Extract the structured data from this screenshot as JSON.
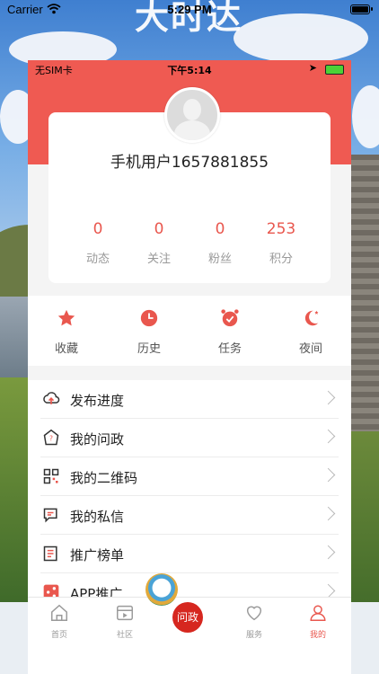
{
  "outer_status": {
    "carrier": "Carrier",
    "time": "5:29 PM"
  },
  "background": {
    "calligraphy": "大时达"
  },
  "inner_status": {
    "carrier": "无SIM卡",
    "time": "下午5:14",
    "location_icon": "location-arrow-icon"
  },
  "profile": {
    "username": "手机用户1657881855",
    "stats": [
      {
        "value": "0",
        "label": "动态"
      },
      {
        "value": "0",
        "label": "关注"
      },
      {
        "value": "0",
        "label": "粉丝"
      },
      {
        "value": "253",
        "label": "积分"
      }
    ]
  },
  "quick_actions": [
    {
      "label": "收藏",
      "icon": "star-icon"
    },
    {
      "label": "历史",
      "icon": "clock-icon"
    },
    {
      "label": "任务",
      "icon": "alarm-clock-icon"
    },
    {
      "label": "夜间",
      "icon": "moon-icon"
    }
  ],
  "menu": [
    {
      "label": "发布进度",
      "icon": "upload-cloud-icon"
    },
    {
      "label": "我的问政",
      "icon": "question-badge-icon"
    },
    {
      "label": "我的二维码",
      "icon": "qr-code-icon"
    },
    {
      "label": "我的私信",
      "icon": "message-icon"
    },
    {
      "label": "推广榜单",
      "icon": "list-icon"
    },
    {
      "label": "APP推广",
      "icon": "share-icon"
    }
  ],
  "tabbar": [
    {
      "label": "首页",
      "icon": "home-icon"
    },
    {
      "label": "社区",
      "icon": "video-icon"
    },
    {
      "label": "问政",
      "icon": "wenzheng-icon"
    },
    {
      "label": "服务",
      "icon": "heart-icon"
    },
    {
      "label": "我的",
      "icon": "user-icon"
    }
  ],
  "colors": {
    "accent": "#EF5A52",
    "stat_number": "#E9574E",
    "active_tab": "#E9574E"
  }
}
